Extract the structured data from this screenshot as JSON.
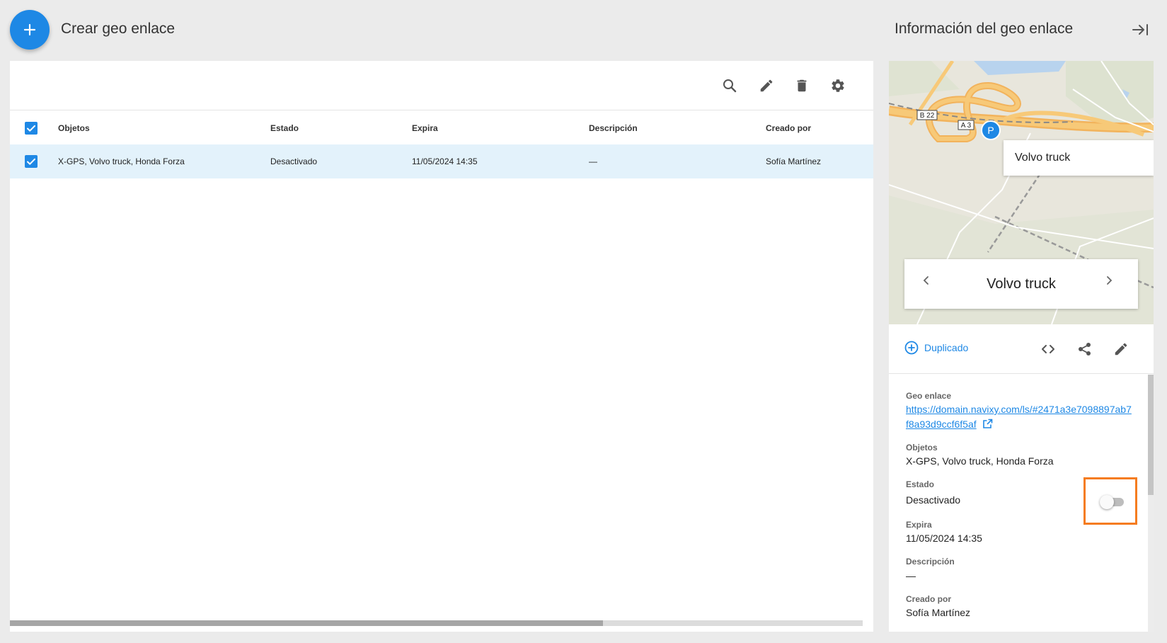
{
  "header": {
    "create_label": "Crear geo enlace",
    "panel_title": "Información del geo enlace"
  },
  "table": {
    "columns": [
      "Objetos",
      "Estado",
      "Expira",
      "Descripción",
      "Creado por"
    ],
    "rows": [
      {
        "objects": "X-GPS, Volvo truck, Honda Forza",
        "status": "Desactivado",
        "expires": "11/05/2024 14:35",
        "description": "—",
        "created_by": "Sofía Martínez",
        "selected": true
      }
    ],
    "toolbar_icons": [
      "search-icon",
      "edit-icon",
      "delete-icon",
      "settings-icon"
    ]
  },
  "map": {
    "road_labels": [
      "B 22",
      "A 3"
    ],
    "marker_letter": "P",
    "popup_label": "Volvo truck",
    "switcher_name": "Volvo truck"
  },
  "actions": {
    "duplicate_label": "Duplicado",
    "icons": [
      "code-icon",
      "share-icon",
      "edit-icon"
    ]
  },
  "details": {
    "geo_link_label": "Geo enlace",
    "geo_link_url": "https://domain.navixy.com/ls/#2471a3e7098897ab7f8a93d9ccf6f5af",
    "objects_label": "Objetos",
    "objects_value": "X-GPS, Volvo truck, Honda Forza",
    "status_label": "Estado",
    "status_value": "Desactivado",
    "status_enabled": false,
    "expires_label": "Expira",
    "expires_value": "11/05/2024 14:35",
    "description_label": "Descripción",
    "description_value": "—",
    "created_by_label": "Creado por",
    "created_by_value": "Sofía Martínez"
  },
  "colors": {
    "accent": "#1e88e5",
    "highlight_border": "#f57c1f",
    "selected_row": "#e3f2fb",
    "background": "#ebebeb"
  }
}
